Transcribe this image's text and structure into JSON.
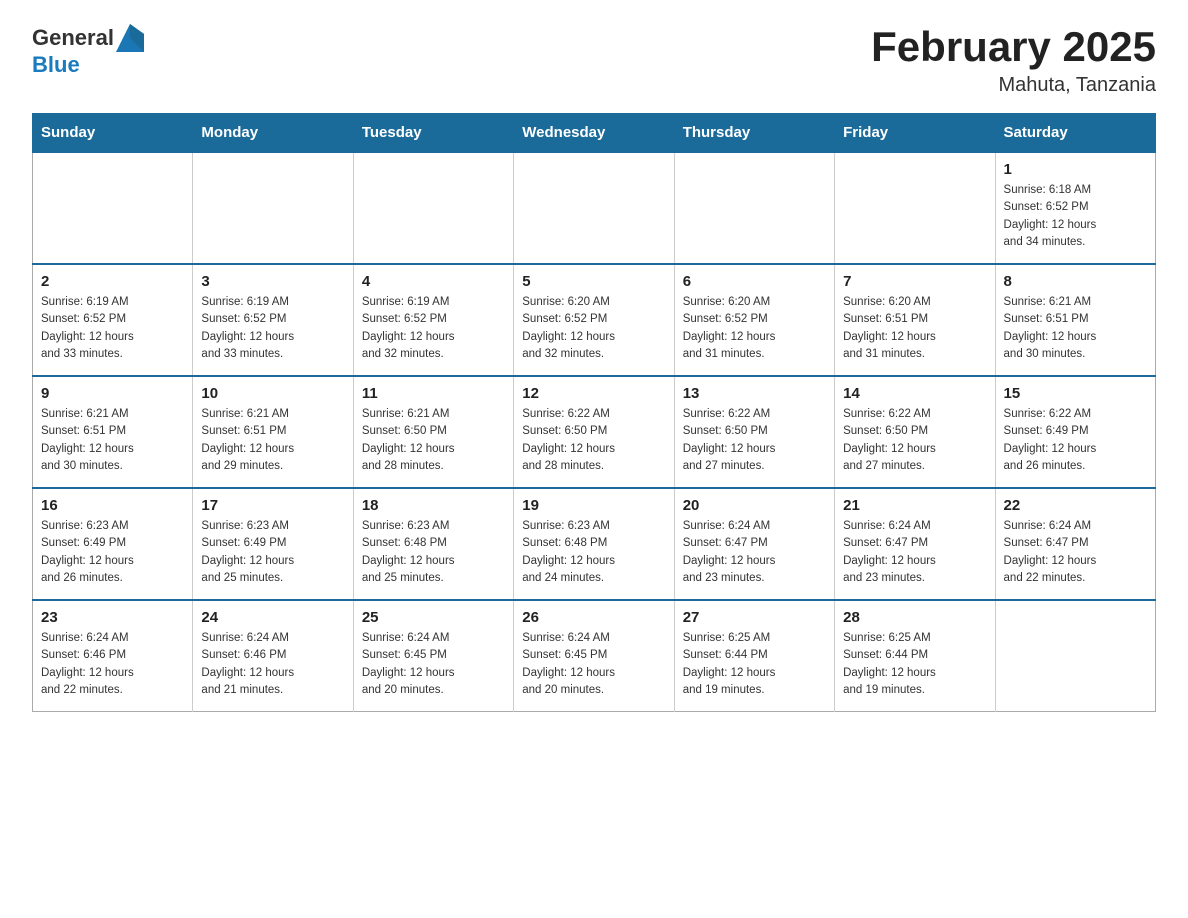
{
  "header": {
    "logo": {
      "text_general": "General",
      "text_blue": "Blue",
      "icon_alt": "generalblue-logo"
    },
    "month_title": "February 2025",
    "location": "Mahuta, Tanzania"
  },
  "calendar": {
    "days_of_week": [
      "Sunday",
      "Monday",
      "Tuesday",
      "Wednesday",
      "Thursday",
      "Friday",
      "Saturday"
    ],
    "weeks": [
      [
        {
          "day": "",
          "info": ""
        },
        {
          "day": "",
          "info": ""
        },
        {
          "day": "",
          "info": ""
        },
        {
          "day": "",
          "info": ""
        },
        {
          "day": "",
          "info": ""
        },
        {
          "day": "",
          "info": ""
        },
        {
          "day": "1",
          "info": "Sunrise: 6:18 AM\nSunset: 6:52 PM\nDaylight: 12 hours\nand 34 minutes."
        }
      ],
      [
        {
          "day": "2",
          "info": "Sunrise: 6:19 AM\nSunset: 6:52 PM\nDaylight: 12 hours\nand 33 minutes."
        },
        {
          "day": "3",
          "info": "Sunrise: 6:19 AM\nSunset: 6:52 PM\nDaylight: 12 hours\nand 33 minutes."
        },
        {
          "day": "4",
          "info": "Sunrise: 6:19 AM\nSunset: 6:52 PM\nDaylight: 12 hours\nand 32 minutes."
        },
        {
          "day": "5",
          "info": "Sunrise: 6:20 AM\nSunset: 6:52 PM\nDaylight: 12 hours\nand 32 minutes."
        },
        {
          "day": "6",
          "info": "Sunrise: 6:20 AM\nSunset: 6:52 PM\nDaylight: 12 hours\nand 31 minutes."
        },
        {
          "day": "7",
          "info": "Sunrise: 6:20 AM\nSunset: 6:51 PM\nDaylight: 12 hours\nand 31 minutes."
        },
        {
          "day": "8",
          "info": "Sunrise: 6:21 AM\nSunset: 6:51 PM\nDaylight: 12 hours\nand 30 minutes."
        }
      ],
      [
        {
          "day": "9",
          "info": "Sunrise: 6:21 AM\nSunset: 6:51 PM\nDaylight: 12 hours\nand 30 minutes."
        },
        {
          "day": "10",
          "info": "Sunrise: 6:21 AM\nSunset: 6:51 PM\nDaylight: 12 hours\nand 29 minutes."
        },
        {
          "day": "11",
          "info": "Sunrise: 6:21 AM\nSunset: 6:50 PM\nDaylight: 12 hours\nand 28 minutes."
        },
        {
          "day": "12",
          "info": "Sunrise: 6:22 AM\nSunset: 6:50 PM\nDaylight: 12 hours\nand 28 minutes."
        },
        {
          "day": "13",
          "info": "Sunrise: 6:22 AM\nSunset: 6:50 PM\nDaylight: 12 hours\nand 27 minutes."
        },
        {
          "day": "14",
          "info": "Sunrise: 6:22 AM\nSunset: 6:50 PM\nDaylight: 12 hours\nand 27 minutes."
        },
        {
          "day": "15",
          "info": "Sunrise: 6:22 AM\nSunset: 6:49 PM\nDaylight: 12 hours\nand 26 minutes."
        }
      ],
      [
        {
          "day": "16",
          "info": "Sunrise: 6:23 AM\nSunset: 6:49 PM\nDaylight: 12 hours\nand 26 minutes."
        },
        {
          "day": "17",
          "info": "Sunrise: 6:23 AM\nSunset: 6:49 PM\nDaylight: 12 hours\nand 25 minutes."
        },
        {
          "day": "18",
          "info": "Sunrise: 6:23 AM\nSunset: 6:48 PM\nDaylight: 12 hours\nand 25 minutes."
        },
        {
          "day": "19",
          "info": "Sunrise: 6:23 AM\nSunset: 6:48 PM\nDaylight: 12 hours\nand 24 minutes."
        },
        {
          "day": "20",
          "info": "Sunrise: 6:24 AM\nSunset: 6:47 PM\nDaylight: 12 hours\nand 23 minutes."
        },
        {
          "day": "21",
          "info": "Sunrise: 6:24 AM\nSunset: 6:47 PM\nDaylight: 12 hours\nand 23 minutes."
        },
        {
          "day": "22",
          "info": "Sunrise: 6:24 AM\nSunset: 6:47 PM\nDaylight: 12 hours\nand 22 minutes."
        }
      ],
      [
        {
          "day": "23",
          "info": "Sunrise: 6:24 AM\nSunset: 6:46 PM\nDaylight: 12 hours\nand 22 minutes."
        },
        {
          "day": "24",
          "info": "Sunrise: 6:24 AM\nSunset: 6:46 PM\nDaylight: 12 hours\nand 21 minutes."
        },
        {
          "day": "25",
          "info": "Sunrise: 6:24 AM\nSunset: 6:45 PM\nDaylight: 12 hours\nand 20 minutes."
        },
        {
          "day": "26",
          "info": "Sunrise: 6:24 AM\nSunset: 6:45 PM\nDaylight: 12 hours\nand 20 minutes."
        },
        {
          "day": "27",
          "info": "Sunrise: 6:25 AM\nSunset: 6:44 PM\nDaylight: 12 hours\nand 19 minutes."
        },
        {
          "day": "28",
          "info": "Sunrise: 6:25 AM\nSunset: 6:44 PM\nDaylight: 12 hours\nand 19 minutes."
        },
        {
          "day": "",
          "info": ""
        }
      ]
    ]
  }
}
